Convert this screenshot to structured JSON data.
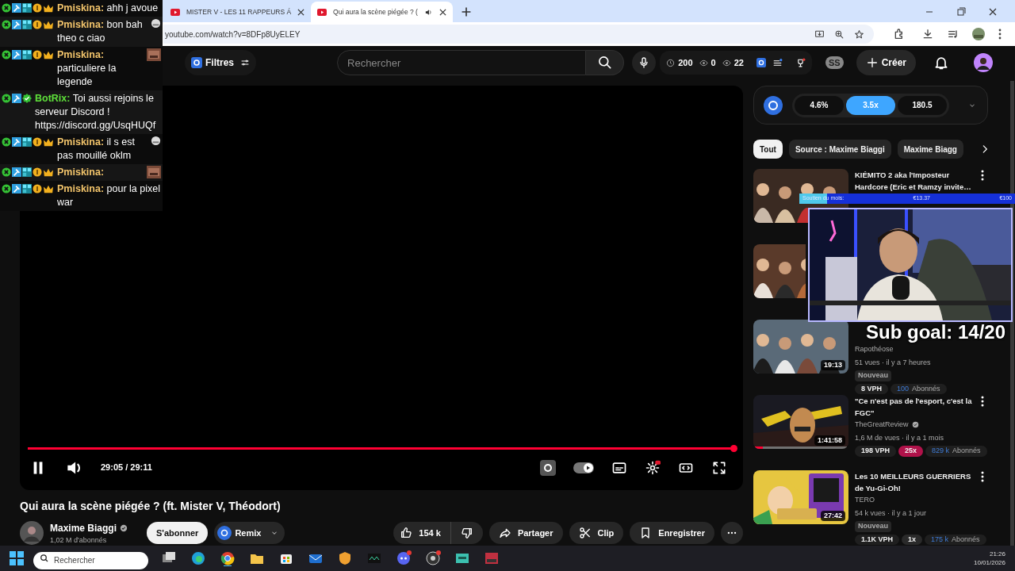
{
  "browser": {
    "tabs": [
      {
        "title": "MISTER V - LES 11 RAPPEURS Á",
        "selected": false,
        "audio": false
      },
      {
        "title": "Qui aura la scène piégée ? (",
        "selected": true,
        "audio": true
      }
    ],
    "url": "youtube.com/watch?v=8DFp8UyELEY"
  },
  "header": {
    "filters": "Filtres",
    "search_placeholder": "Rechercher",
    "stats": [
      {
        "kind": "clock",
        "value": "200"
      },
      {
        "kind": "eye",
        "value": "0"
      },
      {
        "kind": "eye",
        "value": "22"
      }
    ],
    "initials": "SS",
    "create": "Créer"
  },
  "player": {
    "playing": true,
    "progress": {
      "level": 0.998
    },
    "time": "29:05 / 29:11",
    "autoplay": true
  },
  "video": {
    "title": "Qui aura la scène piégée ? (ft. Mister V, Théodort)",
    "channel": "Maxime Biaggi",
    "verified": true,
    "subscribers": "1,02 M d'abonnés",
    "subscribe": "S'abonner",
    "remix": "Remix",
    "likes": "154 k",
    "share": "Partager",
    "clip": "Clip",
    "save": "Enregistrer"
  },
  "sidebar": {
    "metrics": [
      {
        "label": "4.6%",
        "selected": false
      },
      {
        "label": "3.5x",
        "selected": true
      },
      {
        "label": "180.5",
        "selected": false
      }
    ],
    "chips": [
      {
        "label": "Tout",
        "selected": true
      },
      {
        "label": "Source : Maxime Biaggi",
        "selected": false
      },
      {
        "label": "Maxime Biagg",
        "selected": false
      }
    ],
    "videos": [
      {
        "kind": "full",
        "title": "KIÉMITO 2 aka l'Imposteur Hardcore (Eric et Ramzy invite…"
      },
      {
        "kind": "covered"
      },
      {
        "kind": "full",
        "duration": "19:13",
        "channel": "Rapothéose",
        "meta": "51 vues · il y a 7 heures",
        "new": "Nouveau",
        "stats": [
          {
            "kind": "vph",
            "text": "8 VPH"
          },
          {
            "kind": "subs",
            "number": "100",
            "text": "Abonnés"
          }
        ]
      },
      {
        "kind": "full",
        "title": "\"Ce n'est pas de l'esport, c'est la FGC\"",
        "duration": "1:41:58",
        "watched": {
          "level": 0.1
        },
        "channel": "TheGreatReview",
        "verified": true,
        "meta": "1,6 M de vues · il y a 1 mois",
        "stats": [
          {
            "kind": "vph",
            "text": "198 VPH"
          },
          {
            "kind": "ratio",
            "text": "25x",
            "color": "#b0124a"
          },
          {
            "kind": "subs",
            "number": "829 k",
            "text": "Abonnés"
          }
        ]
      },
      {
        "kind": "full",
        "title": "Les 10 MEILLEURS GUERRIERS de Yu-Gi-Oh!",
        "duration": "27:42",
        "channel": "TERO",
        "meta": "54 k vues · il y a 1 jour",
        "new": "Nouveau",
        "stats": [
          {
            "kind": "vph",
            "text": "1.1K VPH"
          },
          {
            "kind": "ratio",
            "text": "1x",
            "color": "#2a2a2a"
          },
          {
            "kind": "subs",
            "number": "175 k",
            "text": "Abonnés"
          }
        ]
      }
    ]
  },
  "overlay": {
    "chat": [
      {
        "kind": "subscriber",
        "user": "Pmiskina:",
        "color": "#f2c46b",
        "text": "ahh j avoue"
      },
      {
        "kind": "subscriber",
        "user": "Pmiskina:",
        "color": "#f2c46b",
        "text": "bon bah theo c ciao",
        "emote": {
          "kind": "grey"
        }
      },
      {
        "kind": "subscriber",
        "user": "Pmiskina:",
        "color": "#f2c46b",
        "text": "particuliere la legende",
        "emote": {
          "kind": "brown"
        }
      },
      {
        "kind": "bot",
        "user": "BotRix:",
        "color": "#5ee03a",
        "text": "Toi aussi rejoins le serveur Discord ! https://discord.gg/UsqHUQf"
      },
      {
        "kind": "subscriber",
        "user": "Pmiskina:",
        "color": "#f2c46b",
        "text": "il s est pas mouillé oklm",
        "emote": {
          "kind": "grey"
        }
      },
      {
        "kind": "subscriber",
        "user": "Pmiskina:",
        "color": "#f2c46b",
        "emote": {
          "kind": "brown"
        }
      },
      {
        "kind": "subscriber",
        "user": "Pmiskina:",
        "color": "#f2c46b",
        "text": "pour la pixel war"
      }
    ],
    "donation": {
      "label": "Soutien du mois:",
      "level": 0.13,
      "current": "€13.37",
      "goal": "€100"
    },
    "sub_goal": "Sub goal: 14/20"
  },
  "taskbar": {
    "search_placeholder": "Rechercher",
    "time": "21:26",
    "date": "10/01/2026"
  }
}
